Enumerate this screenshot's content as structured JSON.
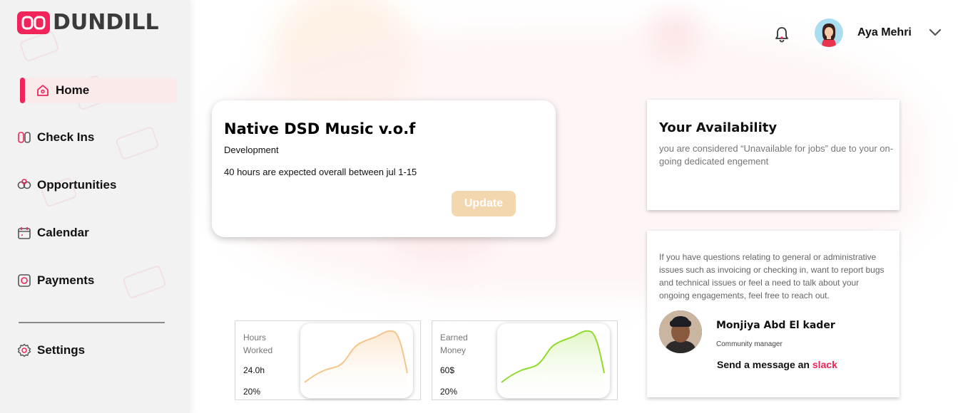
{
  "brand": {
    "name": "DUNDILL",
    "accent": "#f0245a"
  },
  "sidebar": {
    "items": [
      {
        "label": "Home",
        "icon": "home-icon",
        "active": true
      },
      {
        "label": "Check Ins",
        "icon": "check-ins-icon"
      },
      {
        "label": "Opportunities",
        "icon": "opportunities-icon"
      },
      {
        "label": "Calendar",
        "icon": "calendar-icon"
      },
      {
        "label": "Payments",
        "icon": "payments-icon"
      }
    ],
    "settings_label": "Settings"
  },
  "header": {
    "user_name": "Aya Mehri"
  },
  "project": {
    "title": "Native DSD Music v.o.f",
    "category": "Development",
    "hours_text": "40 hours are expected overall between jul 1-15",
    "update_label": "Update"
  },
  "availability": {
    "title": "Your Availability",
    "text": "you are considered “Unavailable for jobs” due to your on-going dedicated engement"
  },
  "contact": {
    "text": "If you have questions relating to general or administrative issues such as invoicing or checking in, want to report bugs and technical issues or feel a need to talk about your ongoing engagements, feel free to reach out.",
    "manager_name": "Monjiya Abd El kader",
    "manager_role": "Community manager",
    "message_prefix": "Send a message an",
    "slack_label": "slack"
  },
  "stats": [
    {
      "label": "Hours Worked",
      "value": "24.0h",
      "percent": "20%",
      "color": "#f5c48c"
    },
    {
      "label": "Earned Money",
      "value": "60$",
      "percent": "20%",
      "color": "#8fdb2a"
    }
  ]
}
